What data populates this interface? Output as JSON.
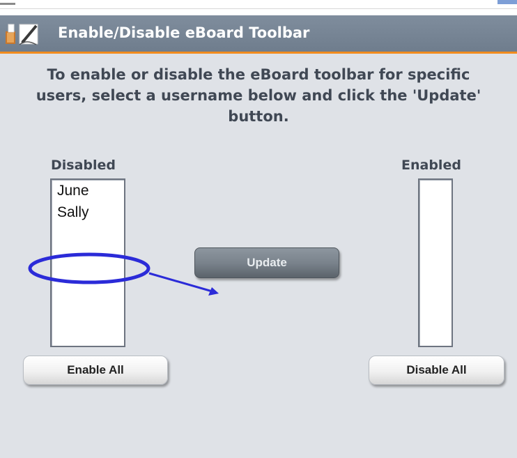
{
  "header": {
    "title": "Enable/Disable eBoard Toolbar",
    "icon": "toolbar-edit-icon",
    "accent_color": "#f28c1e",
    "bar_color": "#7a8898"
  },
  "instructions": {
    "line1": "To enable or disable the eBoard toolbar for specific",
    "line2": "users, select a username below and click the 'Update'",
    "line3": "button."
  },
  "disabled": {
    "label": "Disabled",
    "items": [
      "June",
      "Sally"
    ],
    "button_label": "Enable All"
  },
  "enabled": {
    "label": "Enabled",
    "items": [],
    "button_label": "Disable All"
  },
  "update_button": {
    "label": "Update"
  },
  "annotation": {
    "color": "#2b2bd8",
    "shape": "ellipse-with-arrow"
  }
}
